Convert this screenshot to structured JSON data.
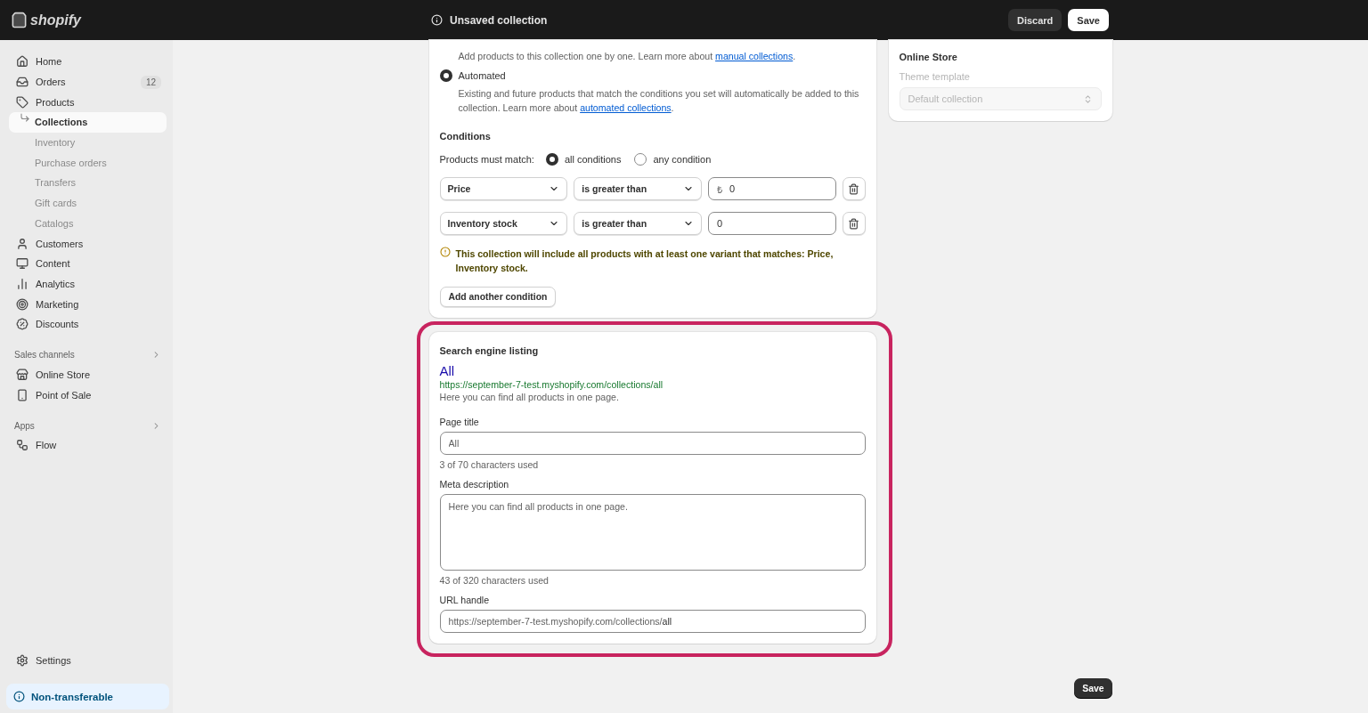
{
  "topbar": {
    "logo": "shopify",
    "title": "Unsaved collection",
    "buttons": [
      {
        "label": "Discard",
        "kind": "secondary"
      },
      {
        "label": "Save",
        "kind": "primary"
      }
    ]
  },
  "sidebar": {
    "items": [
      {
        "label": "Home",
        "selected": false
      },
      {
        "label": "Orders",
        "badge": "12",
        "selected": false
      },
      {
        "label": "Products",
        "selected": false,
        "children": [
          {
            "label": "Collections",
            "selected": true
          },
          {
            "label": "Inventory",
            "selected": false
          },
          {
            "label": "Purchase orders",
            "selected": false
          },
          {
            "label": "Transfers",
            "selected": false
          },
          {
            "label": "Gift cards",
            "selected": false
          },
          {
            "label": "Catalogs",
            "selected": false
          }
        ]
      },
      {
        "label": "Customers",
        "selected": false
      },
      {
        "label": "Content",
        "selected": false
      },
      {
        "label": "Analytics",
        "selected": false
      },
      {
        "label": "Marketing",
        "selected": false
      },
      {
        "label": "Discounts",
        "selected": false
      }
    ],
    "sections": [
      {
        "title": "Sales channels",
        "items": [
          {
            "label": "Online Store",
            "selected": false
          },
          {
            "label": "Point of Sale",
            "selected": false
          }
        ]
      },
      {
        "title": "Apps",
        "items": [
          {
            "label": "Flow",
            "selected": false
          }
        ]
      }
    ],
    "settings": "Settings",
    "notice": "Non-transferable"
  },
  "collection_type": {
    "options": [
      {
        "description": "Add products to this collection one by one. Learn more about",
        "link": "manual collections",
        "suffix": "."
      },
      {
        "label": "Automated",
        "selected": true,
        "description": "Existing and future products that match the conditions you set will automatically be added to this collection. Learn more about",
        "link": "automated collections",
        "suffix": "."
      }
    ]
  },
  "conditions": {
    "title": "Conditions",
    "match_label": "Products must match:",
    "match_options": [
      {
        "label": "all conditions",
        "selected": true
      },
      {
        "label": "any condition",
        "selected": false
      }
    ],
    "rows": [
      {
        "field": "Price",
        "operator": "is greater than",
        "prefix": "₺",
        "value": "0"
      },
      {
        "field": "Inventory stock",
        "operator": "is greater than",
        "value": "0"
      }
    ],
    "notice": "This collection will include all products with at least one variant that matches: Price, Inventory stock.",
    "add_button": "Add another condition"
  },
  "seo": {
    "highlighted": true,
    "title": "Search engine listing",
    "preview_title": "All",
    "preview_url": "https://september-7-test.myshopify.com/collections/all",
    "preview_description": "Here you can find all products in one page.",
    "page_title": {
      "label": "Page title",
      "value": "All",
      "hint": "3 of 70 characters used"
    },
    "meta_description": {
      "label": "Meta description",
      "value": "Here you can find all products in one page.",
      "hint": "43 of 320 characters used"
    },
    "url_handle": {
      "label": "URL handle",
      "prefix": "https://september-7-test.myshopify.com/collections/",
      "value": "all"
    }
  },
  "online_store": {
    "title": "Online Store",
    "field_label": "Theme template",
    "value": "Default collection",
    "disabled": true
  },
  "footer": {
    "save": "Save"
  }
}
